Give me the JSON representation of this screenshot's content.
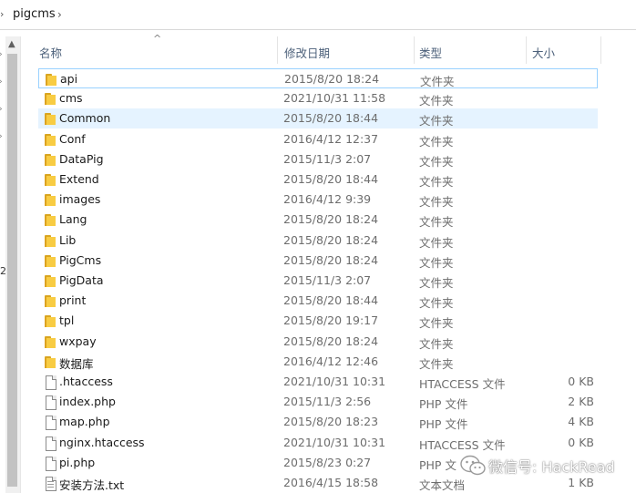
{
  "breadcrumb": {
    "current_folder": "pigcms"
  },
  "columns": {
    "name": "名称",
    "date": "修改日期",
    "type": "类型",
    "size": "大小"
  },
  "nav_strip_char": "2",
  "files": [
    {
      "name": "api",
      "date": "2015/8/20 18:24",
      "type": "文件夹",
      "size": "",
      "icon": "folder-icon",
      "state": "focused"
    },
    {
      "name": "cms",
      "date": "2021/10/31 11:58",
      "type": "文件夹",
      "size": "",
      "icon": "folder-icon",
      "state": ""
    },
    {
      "name": "Common",
      "date": "2015/8/20 18:44",
      "type": "文件夹",
      "size": "",
      "icon": "folder-icon",
      "state": "hovered"
    },
    {
      "name": "Conf",
      "date": "2016/4/12 12:37",
      "type": "文件夹",
      "size": "",
      "icon": "folder-icon",
      "state": ""
    },
    {
      "name": "DataPig",
      "date": "2015/11/3 2:07",
      "type": "文件夹",
      "size": "",
      "icon": "folder-icon",
      "state": ""
    },
    {
      "name": "Extend",
      "date": "2015/8/20 18:44",
      "type": "文件夹",
      "size": "",
      "icon": "folder-icon",
      "state": ""
    },
    {
      "name": "images",
      "date": "2016/4/12 9:39",
      "type": "文件夹",
      "size": "",
      "icon": "folder-icon",
      "state": ""
    },
    {
      "name": "Lang",
      "date": "2015/8/20 18:24",
      "type": "文件夹",
      "size": "",
      "icon": "folder-icon",
      "state": ""
    },
    {
      "name": "Lib",
      "date": "2015/8/20 18:24",
      "type": "文件夹",
      "size": "",
      "icon": "folder-icon",
      "state": ""
    },
    {
      "name": "PigCms",
      "date": "2015/8/20 18:24",
      "type": "文件夹",
      "size": "",
      "icon": "folder-icon",
      "state": ""
    },
    {
      "name": "PigData",
      "date": "2015/11/3 2:07",
      "type": "文件夹",
      "size": "",
      "icon": "folder-icon",
      "state": ""
    },
    {
      "name": "print",
      "date": "2015/8/20 18:44",
      "type": "文件夹",
      "size": "",
      "icon": "folder-icon",
      "state": ""
    },
    {
      "name": "tpl",
      "date": "2015/8/20 19:17",
      "type": "文件夹",
      "size": "",
      "icon": "folder-icon",
      "state": ""
    },
    {
      "name": "wxpay",
      "date": "2015/8/20 18:24",
      "type": "文件夹",
      "size": "",
      "icon": "folder-icon",
      "state": ""
    },
    {
      "name": "数据库",
      "date": "2016/4/12 12:46",
      "type": "文件夹",
      "size": "",
      "icon": "folder-icon",
      "state": ""
    },
    {
      "name": ".htaccess",
      "date": "2021/10/31 10:31",
      "type": "HTACCESS 文件",
      "size": "0 KB",
      "icon": "file-icon",
      "state": ""
    },
    {
      "name": "index.php",
      "date": "2015/11/3 2:56",
      "type": "PHP 文件",
      "size": "2 KB",
      "icon": "file-icon",
      "state": ""
    },
    {
      "name": "map.php",
      "date": "2015/8/20 18:23",
      "type": "PHP 文件",
      "size": "4 KB",
      "icon": "file-icon",
      "state": ""
    },
    {
      "name": "nginx.htaccess",
      "date": "2021/10/31 10:31",
      "type": "HTACCESS 文件",
      "size": "0 KB",
      "icon": "file-icon",
      "state": ""
    },
    {
      "name": "pi.php",
      "date": "2015/8/23 0:27",
      "type": "PHP 文",
      "size": "",
      "icon": "file-icon",
      "state": ""
    },
    {
      "name": "安装方法.txt",
      "date": "2016/4/15 18:58",
      "type": "文本文档",
      "size": "1 KB",
      "icon": "text-file-icon",
      "state": ""
    }
  ],
  "watermark": {
    "text": "微信号: HackRead"
  },
  "colors": {
    "folder_yellow": "#f8cc43",
    "hover_bg": "#e5f3ff",
    "focus_border": "#99d1ff",
    "header_text": "#4c607a",
    "secondary_text": "#6d6d6d"
  }
}
